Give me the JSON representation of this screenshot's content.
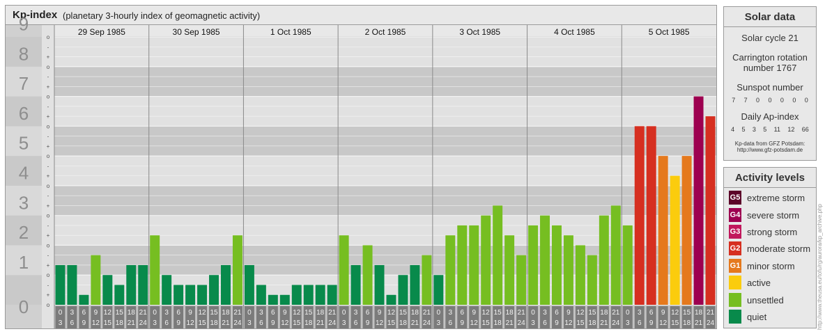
{
  "header": {
    "title": "Kp-index",
    "subtitle": "(planetary 3-hourly index of geomagnetic activity)"
  },
  "chart_data": {
    "type": "bar",
    "title": "Kp-index",
    "subtitle": "(planetary 3-hourly index of geomagnetic activity)",
    "ylim": [
      0,
      9
    ],
    "y_ticks": [
      "0",
      "1",
      "2",
      "3",
      "4",
      "5",
      "6",
      "7",
      "8",
      "9"
    ],
    "y_minor_labels": [
      "+",
      "o",
      "-"
    ],
    "days": [
      "29 Sep 1985",
      "30 Sep 1985",
      "1 Oct 1985",
      "2 Oct 1985",
      "3 Oct 1985",
      "4 Oct 1985",
      "5 Oct 1985"
    ],
    "interval_top": [
      "0",
      "3",
      "6",
      "9",
      "12",
      "15",
      "18",
      "21"
    ],
    "interval_bottom": [
      "3",
      "6",
      "9",
      "12",
      "15",
      "18",
      "21",
      "24"
    ],
    "values": [
      [
        1.333,
        1.333,
        0.333,
        1.667,
        1.0,
        0.667,
        1.333,
        1.333
      ],
      [
        2.333,
        1.0,
        0.667,
        0.667,
        0.667,
        1.0,
        1.333,
        2.333
      ],
      [
        1.333,
        0.667,
        0.333,
        0.333,
        0.667,
        0.667,
        0.667,
        0.667
      ],
      [
        2.333,
        1.333,
        2.0,
        1.333,
        0.333,
        1.0,
        1.333,
        1.667
      ],
      [
        1.0,
        2.333,
        2.667,
        2.667,
        3.0,
        3.333,
        2.333,
        1.667
      ],
      [
        2.667,
        3.0,
        2.667,
        2.333,
        2.0,
        1.667,
        3.0,
        3.333
      ],
      [
        2.667,
        6.0,
        6.0,
        5.0,
        4.333,
        5.0,
        7.0,
        6.333
      ]
    ],
    "color_levels": {
      "quiet": "#088a4b",
      "unsettled": "#76be21",
      "active": "#fbcc0d",
      "minor_storm": "#e5791d",
      "moderate_storm": "#d62f20",
      "strong_storm": "#c1175c",
      "severe_storm": "#9d0050",
      "extreme_storm": "#5c0529"
    },
    "grid": true
  },
  "solar": {
    "title": "Solar data",
    "cycle_label": "Solar cycle 21",
    "carrington_label": "Carrington rotation",
    "carrington_number": "number 1767",
    "sunspot_label": "Sunspot number",
    "sunspot_values": [
      "7",
      "7",
      "0",
      "0",
      "0",
      "0",
      "0"
    ],
    "ap_label": "Daily Ap-index",
    "ap_values": [
      "4",
      "5",
      "3",
      "5",
      "11",
      "12",
      "66"
    ],
    "source_line1": "Kp-data from GFZ Potsdam:",
    "source_line2": "http://www.gfz-potsdam.de"
  },
  "levels": {
    "title": "Activity levels",
    "items": [
      {
        "code": "G5",
        "label": "extreme storm",
        "color": "#5c0529"
      },
      {
        "code": "G4",
        "label": "severe storm",
        "color": "#9d0050"
      },
      {
        "code": "G3",
        "label": "strong storm",
        "color": "#c1175c"
      },
      {
        "code": "G2",
        "label": "moderate storm",
        "color": "#d62f20"
      },
      {
        "code": "G1",
        "label": "minor storm",
        "color": "#e5791d"
      },
      {
        "code": "",
        "label": "active",
        "color": "#fbcc0d"
      },
      {
        "code": "",
        "label": "unsettled",
        "color": "#76be21"
      },
      {
        "code": "",
        "label": "quiet",
        "color": "#088a4b"
      }
    ]
  },
  "credit": "http://www.theusa.eu/tofu/rg/aurora/kp_archive.php"
}
